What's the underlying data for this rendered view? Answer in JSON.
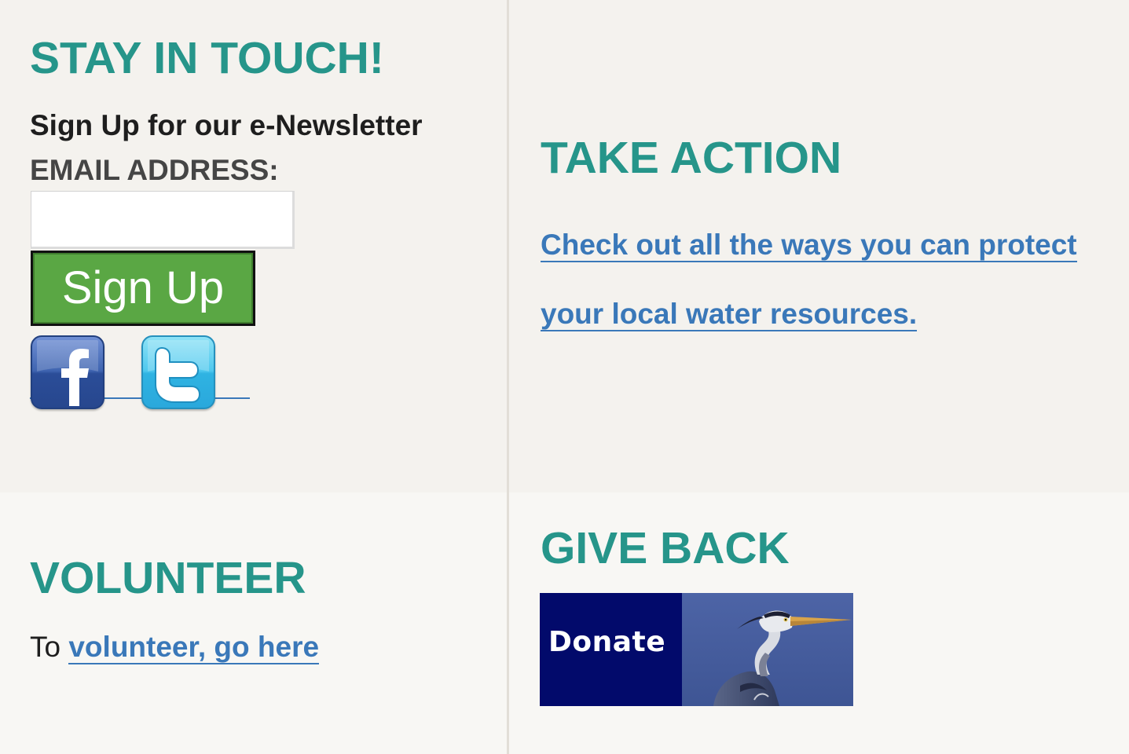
{
  "stay_in_touch": {
    "heading": "STAY IN TOUCH!",
    "newsletter_label": "Sign Up for our e-Newsletter",
    "email_label": "EMAIL ADDRESS:",
    "email_value": "",
    "email_placeholder": "",
    "signup_button": "Sign Up",
    "social": [
      {
        "name": "facebook",
        "icon": "facebook-icon",
        "color": "#3f64b0"
      },
      {
        "name": "twitter",
        "icon": "twitter-icon",
        "color": "#4ec8ee"
      }
    ]
  },
  "take_action": {
    "heading": "TAKE ACTION",
    "link_text": "Check out all the ways you can protect your local water resources. "
  },
  "volunteer": {
    "heading": "VOLUNTEER",
    "prefix": "To ",
    "link_text": "volunteer, go here"
  },
  "give_back": {
    "heading": "GIVE BACK",
    "donate_label": "Donate",
    "donate_image": "heron-photo",
    "donate_color": "#020a6b"
  },
  "colors": {
    "heading": "#26958a",
    "link": "#3a78b9",
    "button_green": "#5aa744",
    "panel_top": "#f4f2ee",
    "panel_bottom": "#f8f7f4"
  }
}
